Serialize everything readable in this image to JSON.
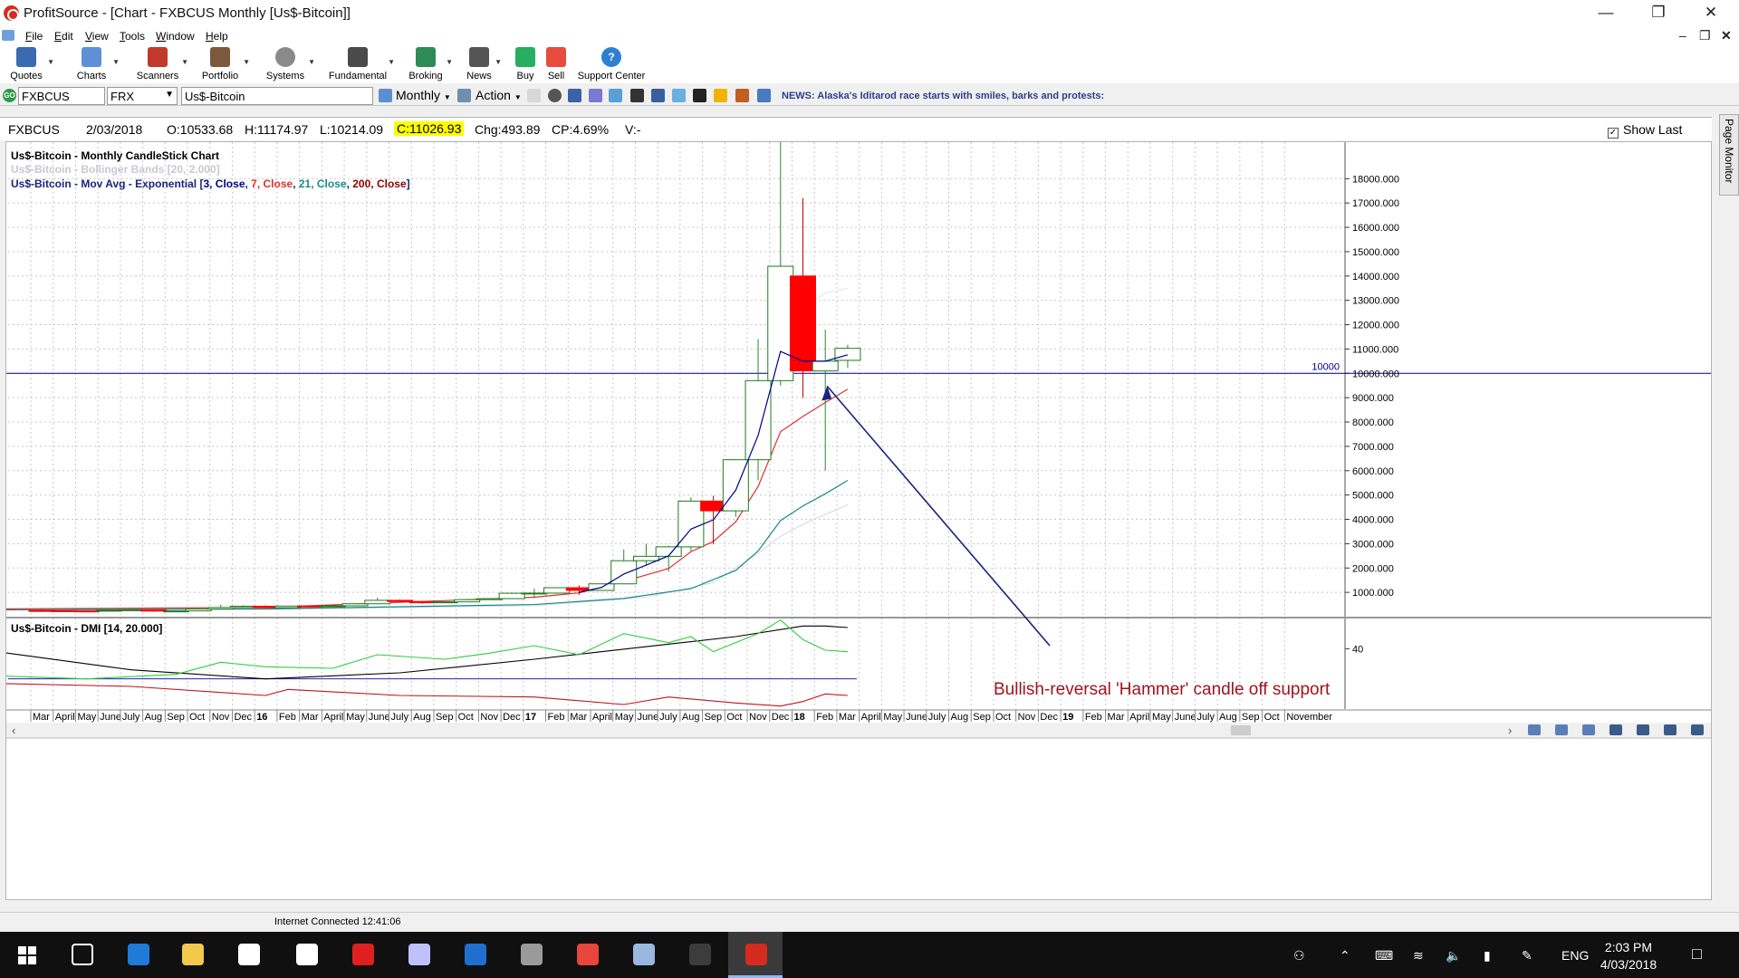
{
  "window": {
    "title": "ProfitSource - [Chart - FXBCUS Monthly [Us$-Bitcoin]]",
    "minimize_icon": "minimize-icon",
    "restore_icon": "restore-icon",
    "close_icon": "close-icon"
  },
  "menu": [
    "File",
    "Edit",
    "View",
    "Tools",
    "Window",
    "Help"
  ],
  "toolbar": [
    {
      "label": "Quotes",
      "icon": "quotes-icon",
      "color": "#3a6ab0"
    },
    {
      "label": "Charts",
      "icon": "charts-icon",
      "color": "#5f8fd8"
    },
    {
      "label": "Scanners",
      "icon": "scanners-icon",
      "color": "#c0392b"
    },
    {
      "label": "Portfolio",
      "icon": "portfolio-icon",
      "color": "#7a5a3a"
    },
    {
      "label": "Systems",
      "icon": "systems-icon",
      "color": "#8a8a8a"
    },
    {
      "label": "Fundamental",
      "icon": "fundamental-icon",
      "color": "#4a4a4a"
    },
    {
      "label": "Broking",
      "icon": "broking-icon",
      "color": "#2e8b57"
    },
    {
      "label": "News",
      "icon": "news-icon",
      "color": "#555555"
    },
    {
      "label": "Buy",
      "icon": "buy-icon",
      "color": "#27ae60"
    },
    {
      "label": "Sell",
      "icon": "sell-icon",
      "color": "#e74c3c"
    },
    {
      "label": "Support Center",
      "icon": "help-icon",
      "color": "#2f7fd1"
    }
  ],
  "symbolbar": {
    "symbol": "FXBCUS",
    "exchange": "FRX",
    "name": "Us$-Bitcoin",
    "period": "Monthly",
    "action": "Action",
    "news": "NEWS: Alaska's Iditarod race starts with smiles, barks and protests:"
  },
  "quote": {
    "symbol": "FXBCUS",
    "date": "2/03/2018",
    "open": "O:10533.68",
    "high": "H:11174.97",
    "low": "L:10214.09",
    "close": "C:11026.93",
    "change": "Chg:493.89",
    "change_pct": "CP:4.69%",
    "volume": "V:-",
    "show_last": "Show Last",
    "show_last_checked": true
  },
  "page_monitor": "Page Monitor",
  "status": "Internet Connected 12:41:06",
  "taskbar": {
    "lang": "ENG",
    "time": "2:03 PM",
    "date": "4/03/2018",
    "apps": [
      {
        "icon": "task-view-icon",
        "color": "#ffffff"
      },
      {
        "icon": "edge-icon",
        "color": "#1f7ad8"
      },
      {
        "icon": "file-explorer-icon",
        "color": "#f2c94c"
      },
      {
        "icon": "store-icon",
        "color": "#ffffff"
      },
      {
        "icon": "calculator-icon",
        "color": "#ffffff"
      },
      {
        "icon": "kaspersky-icon",
        "color": "#e02020"
      },
      {
        "icon": "paint-icon",
        "color": "#c0c0ff"
      },
      {
        "icon": "shield-icon",
        "color": "#1e6fd0"
      },
      {
        "icon": "camera-icon",
        "color": "#9a9a9a"
      },
      {
        "icon": "chrome-icon",
        "color": "#e8453c"
      },
      {
        "icon": "files-icon",
        "color": "#9ab7e0"
      },
      {
        "icon": "go-icon",
        "color": "#3c3c3c"
      },
      {
        "icon": "profitsource-icon",
        "color": "#d52b1e"
      }
    ]
  },
  "chart_data": [
    {
      "type": "candlestick",
      "title": "Us$-Bitcoin - Monthly CandleStick Chart",
      "overlays": [
        {
          "text": "Us$-Bitcoin - Bollinger Bands [20, 2.000]",
          "color": "#c8c8d4"
        },
        {
          "text": "Us$-Bitcoin - Mov Avg - Exponential [3, Close, 7, Close, 21, Close, 200, Close]"
        }
      ],
      "ma_legend": {
        "prefix": "Us$-Bitcoin - Mov Avg - Exponential [",
        "parts": [
          {
            "text": "3, Close",
            "color": "#00008b"
          },
          {
            "text": "7, Close",
            "color": "#e03030"
          },
          {
            "text": "21, Close",
            "color": "#1a8a8a"
          },
          {
            "text": "200, Close",
            "color": "#8b0000"
          }
        ]
      },
      "yaxis": {
        "ticks": [
          1000,
          2000,
          3000,
          4000,
          5000,
          6000,
          7000,
          8000,
          9000,
          10000,
          11000,
          12000,
          13000,
          14000,
          15000,
          16000,
          17000,
          18000
        ],
        "labels": [
          "1000.000",
          "2000.000",
          "3000.000",
          "4000.000",
          "5000.000",
          "6000.000",
          "7000.000",
          "8000.000",
          "9000.000",
          "10000.000",
          "11000.000",
          "12000.000",
          "13000.000",
          "14000.000",
          "15000.000",
          "16000.000",
          "17000.000",
          "18000.000"
        ],
        "range": [
          0,
          19500
        ]
      },
      "xaxis": {
        "labels": [
          "Mar",
          "April",
          "May",
          "June",
          "July",
          "Aug",
          "Sep",
          "Oct",
          "Nov",
          "Dec",
          "16",
          "Feb",
          "Mar",
          "April",
          "May",
          "June",
          "July",
          "Aug",
          "Sep",
          "Oct",
          "Nov",
          "Dec",
          "17",
          "Feb",
          "Mar",
          "April",
          "May",
          "June",
          "July",
          "Aug",
          "Sep",
          "Oct",
          "Nov",
          "Dec",
          "18",
          "Feb",
          "Mar",
          "April",
          "May",
          "June",
          "July",
          "Aug",
          "Sep",
          "Oct",
          "Nov",
          "Dec",
          "19",
          "Feb",
          "Mar",
          "April",
          "May",
          "June",
          "July",
          "Aug",
          "Sep",
          "Oct",
          "November"
        ],
        "bold": [
          "16",
          "17",
          "18",
          "19"
        ]
      },
      "horizontal_line": {
        "value": 10000,
        "label": "10000",
        "color": "#00008b"
      },
      "candles": [
        {
          "m": "Mar 15",
          "o": 254,
          "h": 300,
          "l": 240,
          "c": 244
        },
        {
          "m": "Apr 15",
          "o": 244,
          "h": 262,
          "l": 215,
          "c": 236
        },
        {
          "m": "May 15",
          "o": 236,
          "h": 248,
          "l": 228,
          "c": 230
        },
        {
          "m": "Jun 15",
          "o": 230,
          "h": 268,
          "l": 220,
          "c": 264
        },
        {
          "m": "Jul 15",
          "o": 264,
          "h": 318,
          "l": 254,
          "c": 284
        },
        {
          "m": "Aug 15",
          "o": 284,
          "h": 285,
          "l": 198,
          "c": 230
        },
        {
          "m": "Sep 15",
          "o": 230,
          "h": 245,
          "l": 226,
          "c": 236
        },
        {
          "m": "Oct 15",
          "o": 236,
          "h": 332,
          "l": 236,
          "c": 314
        },
        {
          "m": "Nov 15",
          "o": 314,
          "h": 500,
          "l": 308,
          "c": 377
        },
        {
          "m": "Dec 15",
          "o": 377,
          "h": 468,
          "l": 350,
          "c": 430
        },
        {
          "m": "Jan 16",
          "o": 430,
          "h": 463,
          "l": 354,
          "c": 369
        },
        {
          "m": "Feb 16",
          "o": 369,
          "h": 445,
          "l": 367,
          "c": 437
        },
        {
          "m": "Mar 16",
          "o": 437,
          "h": 440,
          "l": 400,
          "c": 416
        },
        {
          "m": "Apr 16",
          "o": 416,
          "h": 466,
          "l": 414,
          "c": 448
        },
        {
          "m": "May 16",
          "o": 448,
          "h": 550,
          "l": 440,
          "c": 531
        },
        {
          "m": "Jun 16",
          "o": 531,
          "h": 780,
          "l": 520,
          "c": 672
        },
        {
          "m": "Jul 16",
          "o": 672,
          "h": 700,
          "l": 606,
          "c": 624
        },
        {
          "m": "Aug 16",
          "o": 624,
          "h": 628,
          "l": 530,
          "c": 573
        },
        {
          "m": "Sep 16",
          "o": 573,
          "h": 616,
          "l": 570,
          "c": 609
        },
        {
          "m": "Oct 16",
          "o": 609,
          "h": 730,
          "l": 605,
          "c": 700
        },
        {
          "m": "Nov 16",
          "o": 700,
          "h": 755,
          "l": 688,
          "c": 742
        },
        {
          "m": "Dec 16",
          "o": 742,
          "h": 980,
          "l": 740,
          "c": 963
        },
        {
          "m": "Jan 17",
          "o": 963,
          "h": 1150,
          "l": 760,
          "c": 970
        },
        {
          "m": "Feb 17",
          "o": 970,
          "h": 1200,
          "l": 940,
          "c": 1190
        },
        {
          "m": "Mar 17",
          "o": 1190,
          "h": 1290,
          "l": 900,
          "c": 1080
        },
        {
          "m": "Apr 17",
          "o": 1080,
          "h": 1350,
          "l": 1070,
          "c": 1350
        },
        {
          "m": "May 17",
          "o": 1350,
          "h": 2760,
          "l": 1340,
          "c": 2300
        },
        {
          "m": "Jun 17",
          "o": 2300,
          "h": 2990,
          "l": 2100,
          "c": 2480
        },
        {
          "m": "Jul 17",
          "o": 2480,
          "h": 2920,
          "l": 1850,
          "c": 2870
        },
        {
          "m": "Aug 17",
          "o": 2870,
          "h": 4900,
          "l": 2700,
          "c": 4750
        },
        {
          "m": "Sep 17",
          "o": 4750,
          "h": 4970,
          "l": 2970,
          "c": 4350
        },
        {
          "m": "Oct 17",
          "o": 4350,
          "h": 6470,
          "l": 4110,
          "c": 6450
        },
        {
          "m": "Nov 17",
          "o": 6450,
          "h": 11400,
          "l": 5600,
          "c": 9700
        },
        {
          "m": "Dec 17",
          "o": 9700,
          "h": 19600,
          "l": 9500,
          "c": 14400
        },
        {
          "m": "Jan 18",
          "o": 14000,
          "h": 17200,
          "l": 9000,
          "c": 10100
        },
        {
          "m": "Feb 18",
          "o": 10100,
          "h": 11800,
          "l": 6000,
          "c": 10500
        },
        {
          "m": "Mar 18",
          "o": 10533.68,
          "h": 11174.97,
          "l": 10214.09,
          "c": 11026.93
        }
      ],
      "ema3": [
        {
          "m": "Mar 17",
          "v": 1000
        },
        {
          "m": "Apr 17",
          "v": 1200
        },
        {
          "m": "May 17",
          "v": 1750
        },
        {
          "m": "Jun 17",
          "v": 2120
        },
        {
          "m": "Jul 17",
          "v": 2500
        },
        {
          "m": "Aug 17",
          "v": 3600
        },
        {
          "m": "Sep 17",
          "v": 3980
        },
        {
          "m": "Oct 17",
          "v": 5200
        },
        {
          "m": "Nov 17",
          "v": 7450
        },
        {
          "m": "Dec 17",
          "v": 10900
        },
        {
          "m": "Jan 18",
          "v": 10500
        },
        {
          "m": "Feb 18",
          "v": 10500
        },
        {
          "m": "Mar 18",
          "v": 10760
        }
      ],
      "ema7": [
        {
          "m": "Jan 15",
          "v": 320
        },
        {
          "m": "Jan 16",
          "v": 380
        },
        {
          "m": "Jan 17",
          "v": 800
        },
        {
          "m": "Mar 17",
          "v": 980
        },
        {
          "m": "May 17",
          "v": 1450
        },
        {
          "m": "Jul 17",
          "v": 1980
        },
        {
          "m": "Aug 17",
          "v": 2670
        },
        {
          "m": "Sep 17",
          "v": 3090
        },
        {
          "m": "Oct 17",
          "v": 3900
        },
        {
          "m": "Nov 17",
          "v": 5350
        },
        {
          "m": "Dec 17",
          "v": 7600
        },
        {
          "m": "Jan 18",
          "v": 8230
        },
        {
          "m": "Feb 18",
          "v": 8800
        },
        {
          "m": "Mar 18",
          "v": 9350
        }
      ],
      "ema21": [
        {
          "m": "Jan 15",
          "v": 280
        },
        {
          "m": "Jan 16",
          "v": 320
        },
        {
          "m": "Jan 17",
          "v": 500
        },
        {
          "m": "May 17",
          "v": 750
        },
        {
          "m": "Aug 17",
          "v": 1150
        },
        {
          "m": "Oct 17",
          "v": 1900
        },
        {
          "m": "Nov 17",
          "v": 2700
        },
        {
          "m": "Dec 17",
          "v": 3950
        },
        {
          "m": "Jan 18",
          "v": 4550
        },
        {
          "m": "Feb 18",
          "v": 5050
        },
        {
          "m": "Mar 18",
          "v": 5600
        }
      ],
      "bb_mid": [
        {
          "m": "Jan 15",
          "v": 270
        },
        {
          "m": "Jan 16",
          "v": 300
        },
        {
          "m": "Jan 17",
          "v": 450
        },
        {
          "m": "Jun 17",
          "v": 800
        },
        {
          "m": "Sep 17",
          "v": 1400
        },
        {
          "m": "Nov 17",
          "v": 2600
        },
        {
          "m": "Dec 17",
          "v": 3300
        },
        {
          "m": "Jan 18",
          "v": 3800
        },
        {
          "m": "Feb 18",
          "v": 4200
        },
        {
          "m": "Mar 18",
          "v": 4600
        }
      ],
      "bb_upper": [
        {
          "m": "Dec 17",
          "v": 11500
        },
        {
          "m": "Jan 18",
          "v": 12700
        },
        {
          "m": "Feb 18",
          "v": 13300
        },
        {
          "m": "Mar 18",
          "v": 13500
        }
      ],
      "annotation": {
        "text": "Bullish-reversal 'Hammer' candle off support",
        "color": "#a0141e",
        "arrow_to": {
          "m": "Feb 18",
          "v": 9700
        }
      }
    },
    {
      "type": "line",
      "title": "Us$-Bitcoin - DMI [14, 20.000]",
      "yaxis": {
        "ticks": [
          40
        ],
        "labels": [
          "40"
        ],
        "range": [
          0,
          60
        ]
      },
      "threshold": {
        "value": 20,
        "color": "#2020c0"
      },
      "series": [
        {
          "name": "ADX",
          "color": "#000000",
          "values": [
            {
              "m": "Jan 15",
              "v": 38
            },
            {
              "m": "Jul 15",
              "v": 26
            },
            {
              "m": "Jan 16",
              "v": 20
            },
            {
              "m": "Jul 16",
              "v": 24
            },
            {
              "m": "Jan 17",
              "v": 33
            },
            {
              "m": "Jul 17",
              "v": 43
            },
            {
              "m": "Oct 17",
              "v": 48
            },
            {
              "m": "Jan 18",
              "v": 55
            },
            {
              "m": "Feb 18",
              "v": 55
            },
            {
              "m": "Mar 18",
              "v": 54
            }
          ]
        },
        {
          "name": "+DI",
          "color": "#2ecc40",
          "values": [
            {
              "m": "Jan 15",
              "v": 22
            },
            {
              "m": "May 15",
              "v": 20
            },
            {
              "m": "Sep 15",
              "v": 23
            },
            {
              "m": "Nov 15",
              "v": 31
            },
            {
              "m": "Jan 16",
              "v": 28
            },
            {
              "m": "Apr 16",
              "v": 27
            },
            {
              "m": "Jun 16",
              "v": 36
            },
            {
              "m": "Sep 16",
              "v": 33
            },
            {
              "m": "Nov 16",
              "v": 37
            },
            {
              "m": "Jan 17",
              "v": 42
            },
            {
              "m": "Mar 17",
              "v": 36
            },
            {
              "m": "May 17",
              "v": 50
            },
            {
              "m": "Jul 17",
              "v": 44
            },
            {
              "m": "Aug 17",
              "v": 48
            },
            {
              "m": "Sep 17",
              "v": 38
            },
            {
              "m": "Oct 17",
              "v": 44
            },
            {
              "m": "Nov 17",
              "v": 50
            },
            {
              "m": "Dec 17",
              "v": 59
            },
            {
              "m": "Jan 18",
              "v": 46
            },
            {
              "m": "Feb 18",
              "v": 39
            },
            {
              "m": "Mar 18",
              "v": 38
            }
          ]
        },
        {
          "name": "-DI",
          "color": "#c0141e",
          "values": [
            {
              "m": "Jan 15",
              "v": 17
            },
            {
              "m": "Jul 15",
              "v": 15
            },
            {
              "m": "Jan 16",
              "v": 9
            },
            {
              "m": "Feb 16",
              "v": 13
            },
            {
              "m": "Jul 16",
              "v": 9
            },
            {
              "m": "Jan 17",
              "v": 8
            },
            {
              "m": "May 17",
              "v": 3
            },
            {
              "m": "Jul 17",
              "v": 8
            },
            {
              "m": "Oct 17",
              "v": 4
            },
            {
              "m": "Dec 17",
              "v": 2
            },
            {
              "m": "Jan 18",
              "v": 5
            },
            {
              "m": "Feb 18",
              "v": 10
            },
            {
              "m": "Mar 18",
              "v": 9
            }
          ]
        }
      ]
    }
  ]
}
